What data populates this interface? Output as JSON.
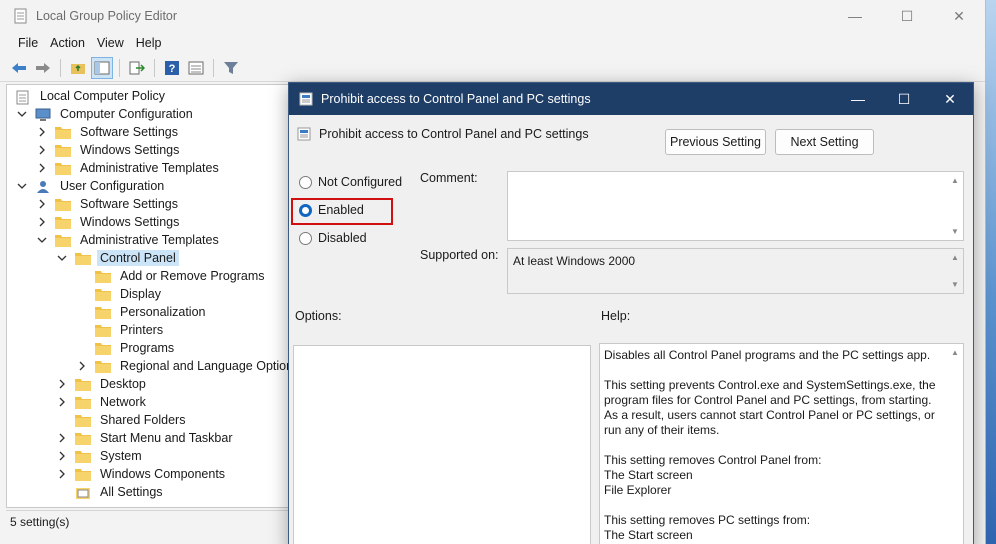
{
  "window": {
    "title": "Local Group Policy Editor",
    "controls": {
      "minimize": "—",
      "maximize": "☐",
      "close": "✕"
    }
  },
  "menu": [
    "File",
    "Action",
    "View",
    "Help"
  ],
  "toolbar_icons": [
    "back-arrow-icon",
    "forward-arrow-icon",
    "up-folder-icon",
    "show-hide-tree-icon",
    "export-list-icon",
    "help-icon",
    "properties-view-icon",
    "filter-icon"
  ],
  "tree": [
    {
      "label": "Local Computer Policy",
      "depth": 0,
      "chev": "none",
      "icon": "policy-icon"
    },
    {
      "label": "Computer Configuration",
      "depth": 1,
      "chev": "down",
      "icon": "computer-icon"
    },
    {
      "label": "Software Settings",
      "depth": 2,
      "chev": "right",
      "icon": "folder-icon"
    },
    {
      "label": "Windows Settings",
      "depth": 2,
      "chev": "right",
      "icon": "folder-icon"
    },
    {
      "label": "Administrative Templates",
      "depth": 2,
      "chev": "right",
      "icon": "folder-icon"
    },
    {
      "label": "User Configuration",
      "depth": 1,
      "chev": "down",
      "icon": "user-icon"
    },
    {
      "label": "Software Settings",
      "depth": 2,
      "chev": "right",
      "icon": "folder-icon"
    },
    {
      "label": "Windows Settings",
      "depth": 2,
      "chev": "right",
      "icon": "folder-icon"
    },
    {
      "label": "Administrative Templates",
      "depth": 2,
      "chev": "down",
      "icon": "folder-icon"
    },
    {
      "label": "Control Panel",
      "depth": 3,
      "chev": "down",
      "icon": "folder-icon",
      "selected": true
    },
    {
      "label": "Add or Remove Programs",
      "depth": 4,
      "chev": "none",
      "icon": "folder-icon"
    },
    {
      "label": "Display",
      "depth": 4,
      "chev": "none",
      "icon": "folder-icon"
    },
    {
      "label": "Personalization",
      "depth": 4,
      "chev": "none",
      "icon": "folder-icon"
    },
    {
      "label": "Printers",
      "depth": 4,
      "chev": "none",
      "icon": "folder-icon"
    },
    {
      "label": "Programs",
      "depth": 4,
      "chev": "none",
      "icon": "folder-icon"
    },
    {
      "label": "Regional and Language Options",
      "depth": 4,
      "chev": "right",
      "icon": "folder-icon"
    },
    {
      "label": "Desktop",
      "depth": 3,
      "chev": "right",
      "icon": "folder-icon"
    },
    {
      "label": "Network",
      "depth": 3,
      "chev": "right",
      "icon": "folder-icon"
    },
    {
      "label": "Shared Folders",
      "depth": 3,
      "chev": "none",
      "icon": "folder-icon"
    },
    {
      "label": "Start Menu and Taskbar",
      "depth": 3,
      "chev": "right",
      "icon": "folder-icon"
    },
    {
      "label": "System",
      "depth": 3,
      "chev": "right",
      "icon": "folder-icon"
    },
    {
      "label": "Windows Components",
      "depth": 3,
      "chev": "right",
      "icon": "folder-icon"
    },
    {
      "label": "All Settings",
      "depth": 3,
      "chev": "none",
      "icon": "all-settings-icon"
    }
  ],
  "status": "5 setting(s)",
  "dialog": {
    "title": "Prohibit access to Control Panel and PC settings",
    "setting_name": "Prohibit access to Control Panel and PC settings",
    "prev_button": "Previous Setting",
    "next_button": "Next Setting",
    "radios": [
      {
        "label": "Not Configured",
        "selected": false
      },
      {
        "label": "Enabled",
        "selected": true
      },
      {
        "label": "Disabled",
        "selected": false
      }
    ],
    "comment_label": "Comment:",
    "supported_label": "Supported on:",
    "supported_value": "At least Windows 2000",
    "options_label": "Options:",
    "help_label": "Help:",
    "help_paragraphs": [
      "Disables all Control Panel programs and the PC settings app.",
      "This setting prevents Control.exe and SystemSettings.exe, the program files for Control Panel and PC settings, from starting. As a result, users cannot start Control Panel or PC settings, or run any of their items.",
      "This setting removes Control Panel from:\nThe Start screen\nFile Explorer",
      "This setting removes PC settings from:\nThe Start screen"
    ]
  },
  "colors": {
    "dialog_title_bg": "#1e3e68",
    "selection": "#cce4f7",
    "highlight_box": "#d01010",
    "radio_accent": "#1166c2"
  }
}
